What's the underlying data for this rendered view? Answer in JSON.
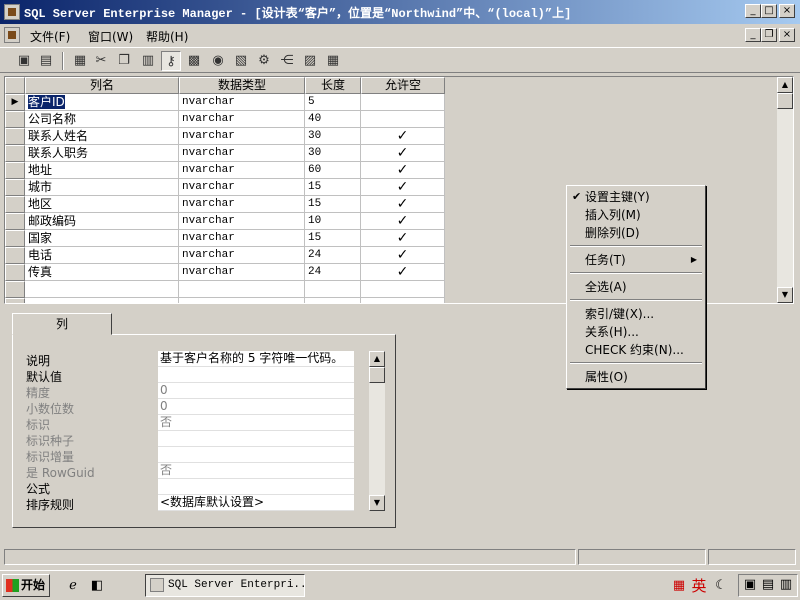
{
  "window": {
    "title": "SQL Server Enterprise Manager - [设计表“客户”，位置是“Northwind”中、“(local)”上]",
    "minimize": "_",
    "maximize": "□",
    "close": "×"
  },
  "menubar": {
    "items": [
      "文件(F)",
      "窗口(W)",
      "帮助(H)"
    ],
    "mdi_min": "_",
    "mdi_restore": "❐",
    "mdi_close": "×"
  },
  "grid": {
    "headers": [
      "列名",
      "数据类型",
      "长度",
      "允许空"
    ],
    "key_marker": "▶",
    "rows": [
      {
        "name": "客户ID",
        "type": "nvarchar",
        "length": "5",
        "nullable": ""
      },
      {
        "name": "公司名称",
        "type": "nvarchar",
        "length": "40",
        "nullable": ""
      },
      {
        "name": "联系人姓名",
        "type": "nvarchar",
        "length": "30",
        "nullable": "✓"
      },
      {
        "name": "联系人职务",
        "type": "nvarchar",
        "length": "30",
        "nullable": "✓"
      },
      {
        "name": "地址",
        "type": "nvarchar",
        "length": "60",
        "nullable": "✓"
      },
      {
        "name": "城市",
        "type": "nvarchar",
        "length": "15",
        "nullable": "✓"
      },
      {
        "name": "地区",
        "type": "nvarchar",
        "length": "15",
        "nullable": "✓"
      },
      {
        "name": "邮政编码",
        "type": "nvarchar",
        "length": "10",
        "nullable": "✓"
      },
      {
        "name": "国家",
        "type": "nvarchar",
        "length": "15",
        "nullable": "✓"
      },
      {
        "name": "电话",
        "type": "nvarchar",
        "length": "24",
        "nullable": "✓"
      },
      {
        "name": "传真",
        "type": "nvarchar",
        "length": "24",
        "nullable": "✓"
      }
    ]
  },
  "properties": {
    "tab_label": "列",
    "rows": [
      {
        "label": "说明",
        "value": "基于客户名称的 5 字符唯一代码。",
        "disabled": false
      },
      {
        "label": "默认值",
        "value": "",
        "disabled": false
      },
      {
        "label": "精度",
        "value": "0",
        "disabled": true
      },
      {
        "label": "小数位数",
        "value": "0",
        "disabled": true
      },
      {
        "label": "标识",
        "value": "否",
        "disabled": true
      },
      {
        "label": "标识种子",
        "value": "",
        "disabled": true
      },
      {
        "label": "标识增量",
        "value": "",
        "disabled": true
      },
      {
        "label": "是 RowGuid",
        "value": "否",
        "disabled": true
      },
      {
        "label": "公式",
        "value": "",
        "disabled": false
      },
      {
        "label": "排序规则",
        "value": "<数据库默认设置>",
        "disabled": false
      }
    ]
  },
  "context_menu": {
    "items": [
      {
        "label": "设置主键(Y)",
        "checked": true,
        "submenu": false
      },
      {
        "label": "插入列(M)",
        "checked": false,
        "submenu": false
      },
      {
        "label": "删除列(D)",
        "checked": false,
        "submenu": false
      },
      {
        "sep": true
      },
      {
        "label": "任务(T)",
        "checked": false,
        "submenu": true
      },
      {
        "sep": true
      },
      {
        "label": "全选(A)",
        "checked": false,
        "submenu": false
      },
      {
        "sep": true
      },
      {
        "label": "索引/键(X)...",
        "checked": false,
        "submenu": false
      },
      {
        "label": "关系(H)...",
        "checked": false,
        "submenu": false
      },
      {
        "label": "CHECK 约束(N)...",
        "checked": false,
        "submenu": false
      },
      {
        "sep": true
      },
      {
        "label": "属性(O)",
        "checked": false,
        "submenu": false
      }
    ]
  },
  "taskbar": {
    "start_label": "开始",
    "task_label": "SQL Server Enterpri...",
    "ime_label": "英"
  }
}
